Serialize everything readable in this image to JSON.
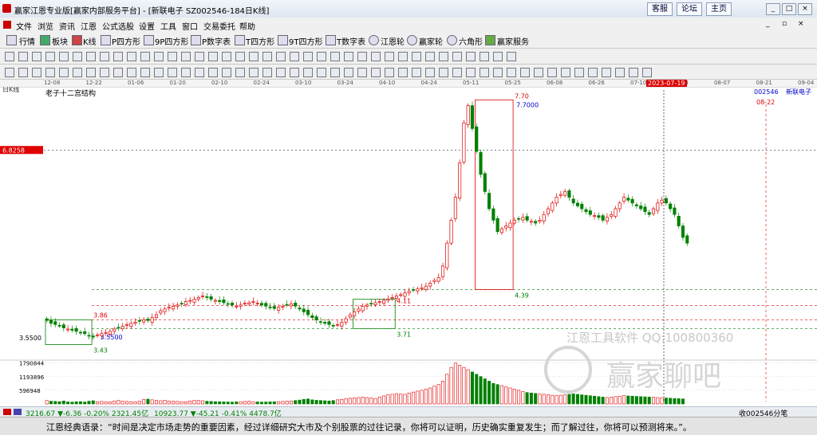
{
  "window": {
    "title": "赢家江恩专业版[赢家内部服务平台] - [新联电子  SZ002546-184日K线]",
    "top_buttons": [
      "客服",
      "论坛",
      "主页"
    ]
  },
  "menu": [
    "文件",
    "浏览",
    "资讯",
    "江恩",
    "公式选股",
    "设置",
    "工具",
    "窗口",
    "交易委托",
    "帮助"
  ],
  "toolbar": [
    "行情",
    "板块",
    "K线",
    "P四方形",
    "9P四方形",
    "P数字表",
    "T四方形",
    "9T四方形",
    "T数字表",
    "江恩轮",
    "赢家轮",
    "六角形",
    "赢家服务"
  ],
  "period_label": "日K线",
  "date_ticks": [
    "12-08",
    "12-22",
    "01-06",
    "01-20",
    "02-10",
    "02-24",
    "03-10",
    "03-24",
    "04-10",
    "04-24",
    "05-11",
    "05-25",
    "06-08",
    "06-26",
    "07-10",
    "07-24",
    "08-07",
    "08-21",
    "09-04"
  ],
  "cursor_date": "2023-07-19",
  "stock_code": "002546",
  "stock_name": "新联电子",
  "right_date": "08-22",
  "indicator_name": "老子十二宫结构",
  "price_axis_label": "6.8258",
  "price_low_label": "3.5500",
  "volume_axis": [
    "1790844",
    "1193896",
    "596948"
  ],
  "annotations": {
    "high_7_70": "7.70",
    "high_7_7000": "7.7000",
    "low_4_39": "4.39",
    "level_3_86": "3.86",
    "level_3_43": "3.43",
    "level_3_5500": "3.5500",
    "level_4_11": "4.11",
    "level_3_71": "3.71"
  },
  "watermark": {
    "line1": "江恩工具软件   QQ:100800360",
    "line2": "赢家聊吧"
  },
  "status": {
    "sh": "3216.67 ▼-6.36 -0.20% 2321.45亿",
    "sz": "10923.77 ▼-45.21 -0.41% 4478.7亿",
    "right": "收002546分笔"
  },
  "quote": "江恩经典语录：“时间是决定市场走势的重要因素，经过详细研究大市及个别股票的过往记录，你将可以证明，历史确实重复发生；而了解过往，你将可以预测将来。”。",
  "colors": {
    "up": "#e00000",
    "down": "#008000",
    "box": "#e00000",
    "box_green": "#008000"
  },
  "chart_data": {
    "type": "candlestick",
    "title": "",
    "indicator": "老子十二宫结构",
    "ylim": [
      3.2,
      7.9
    ],
    "labels": {
      "high": 7.7,
      "high_marker": 7.7,
      "low_major": 4.39,
      "level_a": 3.86,
      "level_b": 3.43,
      "level_c": 3.55,
      "level_d": 4.11,
      "level_e": 3.71,
      "crosshair": 6.8258
    },
    "closes": [
      3.85,
      3.8,
      3.78,
      3.76,
      3.72,
      3.7,
      3.68,
      3.66,
      3.64,
      3.62,
      3.58,
      3.56,
      3.6,
      3.62,
      3.64,
      3.66,
      3.7,
      3.72,
      3.75,
      3.78,
      3.8,
      3.82,
      3.84,
      3.86,
      3.85,
      3.9,
      3.95,
      4.02,
      4.05,
      4.08,
      4.1,
      4.12,
      4.14,
      4.18,
      4.2,
      4.22,
      4.25,
      4.28,
      4.25,
      4.22,
      4.2,
      4.18,
      4.16,
      4.14,
      4.12,
      4.1,
      4.12,
      4.15,
      4.16,
      4.18,
      4.15,
      4.12,
      4.1,
      4.08,
      4.06,
      4.08,
      4.1,
      4.12,
      4.14,
      4.1,
      4.05,
      4.0,
      3.95,
      3.9,
      3.86,
      3.82,
      3.8,
      3.78,
      3.76,
      3.78,
      3.82,
      3.88,
      3.95,
      4.0,
      4.05,
      4.1,
      4.12,
      4.14,
      4.16,
      4.18,
      4.2,
      4.22,
      4.25,
      4.28,
      4.3,
      4.33,
      4.36,
      4.38,
      4.4,
      4.42,
      4.45,
      4.5,
      4.55,
      4.6,
      4.8,
      5.2,
      5.6,
      6.0,
      6.6,
      7.3,
      7.6,
      7.2,
      6.8,
      6.4,
      6.1,
      5.8,
      5.6,
      5.4,
      5.45,
      5.5,
      5.55,
      5.6,
      5.62,
      5.65,
      5.6,
      5.58,
      5.55,
      5.6,
      5.7,
      5.8,
      5.9,
      6.0,
      6.05,
      6.1,
      6.0,
      5.9,
      5.85,
      5.8,
      5.75,
      5.7,
      5.68,
      5.65,
      5.6,
      5.65,
      5.7,
      5.8,
      5.9,
      6.0,
      5.95,
      5.9,
      5.85,
      5.8,
      5.75,
      5.7,
      5.8,
      5.9,
      5.95,
      5.9,
      5.8,
      5.7,
      5.5,
      5.3,
      5.2
    ],
    "volume_ticks": [
      596948,
      1193896,
      1790844
    ],
    "volumes": [
      150000,
      120000,
      110000,
      100000,
      130000,
      90000,
      80000,
      95000,
      100000,
      85000,
      120000,
      140000,
      100000,
      110000,
      95000,
      90000,
      130000,
      150000,
      120000,
      110000,
      100000,
      95000,
      120000,
      200000,
      210000,
      180000,
      150000,
      140000,
      160000,
      130000,
      120000,
      110000,
      100000,
      95000,
      130000,
      160000,
      150000,
      140000,
      120000,
      110000,
      100000,
      95000,
      90000,
      85000,
      80000,
      90000,
      100000,
      110000,
      120000,
      100000,
      90000,
      80000,
      85000,
      90000,
      95000,
      100000,
      110000,
      120000,
      130000,
      150000,
      170000,
      200000,
      220000,
      180000,
      160000,
      150000,
      140000,
      130000,
      150000,
      180000,
      200000,
      230000,
      250000,
      270000,
      280000,
      300000,
      280000,
      260000,
      240000,
      300000,
      350000,
      400000,
      420000,
      450000,
      430000,
      420000,
      480000,
      520000,
      560000,
      600000,
      650000,
      700000,
      780000,
      850000,
      1000000,
      1300000,
      1600000,
      1790000,
      1700000,
      1600000,
      1500000,
      1400000,
      1300000,
      1200000,
      1100000,
      1000000,
      900000,
      850000,
      800000,
      750000,
      700000,
      650000,
      600000,
      550000,
      500000,
      480000,
      460000,
      440000,
      420000,
      400000,
      380000,
      360000,
      380000,
      400000,
      420000,
      440000,
      420000,
      400000,
      380000,
      360000,
      340000,
      320000,
      300000,
      280000,
      300000,
      320000,
      340000,
      360000,
      350000,
      340000,
      330000,
      320000,
      310000,
      300000,
      290000,
      280000,
      270000,
      260000,
      250000,
      240000,
      230000,
      220000
    ]
  }
}
